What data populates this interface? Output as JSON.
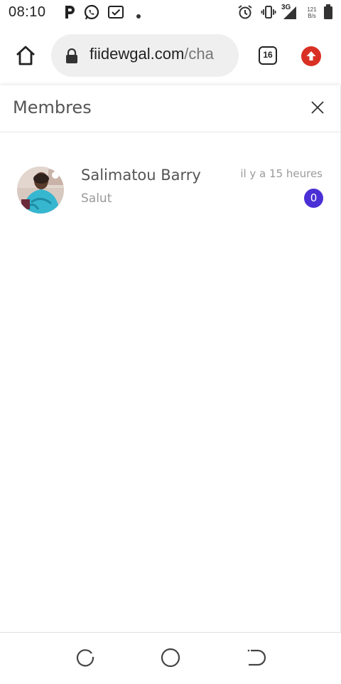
{
  "statusbar": {
    "time": "08:10",
    "network": "3G",
    "speed_value": "121",
    "speed_unit": "B/s",
    "icons": [
      "parking-icon",
      "whatsapp-icon",
      "checkbox-icon",
      "dot-icon",
      "alarm-icon",
      "vibrate-icon",
      "signal-icon",
      "battery-icon"
    ]
  },
  "browser": {
    "url_domain": "fiidewgal.com",
    "url_path": "/cha",
    "tab_count": "16",
    "extension_color": "#d93025"
  },
  "panel": {
    "title": "Membres"
  },
  "members": [
    {
      "name": "Salimatou Barry",
      "last_message": "Salut",
      "time": "il y a 15 heures",
      "unread_count": "0",
      "badge_color": "#4b2fd6"
    }
  ],
  "navbar": {
    "buttons": [
      "recents-icon",
      "home-circle-icon",
      "back-icon"
    ]
  }
}
